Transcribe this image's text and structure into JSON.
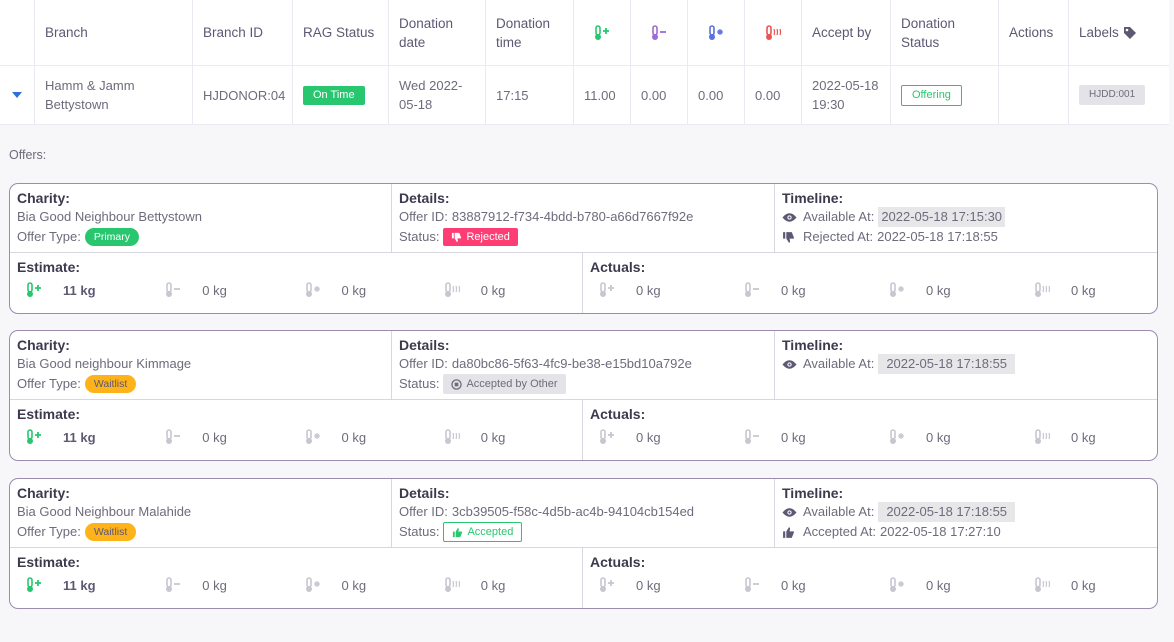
{
  "table": {
    "headers": {
      "branch": "Branch",
      "branch_id": "Branch ID",
      "rag_status": "RAG Status",
      "donation_date": "Donation date",
      "donation_time": "Donation time",
      "accept_by": "Accept by",
      "donation_status": "Donation Status",
      "actions": "Actions",
      "labels": "Labels"
    },
    "row": {
      "branch": "Hamm & Jamm Bettystown",
      "branch_id": "HJDONOR:04",
      "rag_status": "On Time",
      "donation_date": "Wed 2022-05-18",
      "donation_time": "17:15",
      "ambient": "11.00",
      "chilled": "0.00",
      "frozen": "0.00",
      "hot": "0.00",
      "accept_by": "2022-05-18 19:30",
      "donation_status": "Offering",
      "label": "HJDD:001"
    }
  },
  "offers_title": "Offers:",
  "labels": {
    "charity": "Charity:",
    "details": "Details:",
    "timeline": "Timeline:",
    "estimate": "Estimate:",
    "actuals": "Actuals:",
    "offer_type": "Offer Type:",
    "offer_id": "Offer ID:",
    "status": "Status:",
    "available_at": "Available At:"
  },
  "offers": [
    {
      "charity": "Bia Good Neighbour Bettystown",
      "offer_type": "Primary",
      "offer_id": "83887912-f734-4bdd-b780-a66d7667f92e",
      "status": "Rejected",
      "available_at": "2022-05-18 17:15:30",
      "second_event_label": "Rejected At:",
      "second_event_value": "2022-05-18 17:18:55",
      "estimate": [
        "11 kg",
        "0 kg",
        "0 kg",
        "0 kg"
      ],
      "actuals": [
        "0 kg",
        "0 kg",
        "0 kg",
        "0 kg"
      ]
    },
    {
      "charity": "Bia Good neighbour Kimmage",
      "offer_type": "Waitlist",
      "offer_id": "da80bc86-5f63-4fc9-be38-e15bd10a792e",
      "status": "Accepted by Other",
      "available_at": "2022-05-18 17:18:55",
      "estimate": [
        "11 kg",
        "0 kg",
        "0 kg",
        "0 kg"
      ],
      "actuals": [
        "0 kg",
        "0 kg",
        "0 kg",
        "0 kg"
      ]
    },
    {
      "charity": "Bia Good Neighbour Malahide",
      "offer_type": "Waitlist",
      "offer_id": "3cb39505-f58c-4d5b-ac4b-94104cb154ed",
      "status": "Accepted",
      "available_at": "2022-05-18 17:18:55",
      "second_event_label": "Accepted At:",
      "second_event_value": "2022-05-18 17:27:10",
      "estimate": [
        "11 kg",
        "0 kg",
        "0 kg",
        "0 kg"
      ],
      "actuals": [
        "0 kg",
        "0 kg",
        "0 kg",
        "0 kg"
      ]
    }
  ],
  "colors": {
    "ambient": "#28c76f",
    "chilled": "#9e6ad6",
    "frozen": "#5a6fe0",
    "hot": "#ea5455",
    "rejected": "#ff3d75",
    "accepted": "#28c76f",
    "waitlist": "#ffb31a",
    "card_border": "#9d8bb0"
  }
}
